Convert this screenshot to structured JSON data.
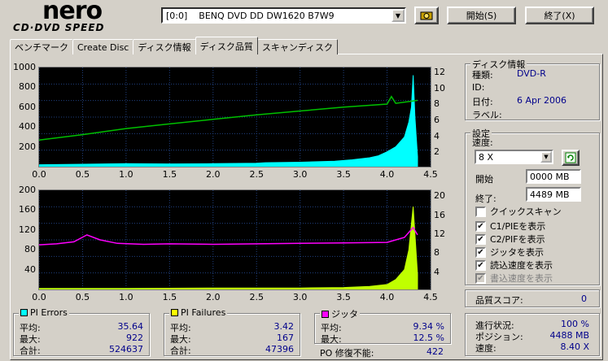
{
  "header": {
    "logo_main": "nero",
    "logo_sub": "CD·DVD SPEED",
    "drive": "[0:0]    BENQ DVD DD DW1620 B7W9",
    "start_button": "開始(S)",
    "exit_button": "終了(X)"
  },
  "tabs": [
    {
      "label": "ベンチマーク"
    },
    {
      "label": "Create Disc"
    },
    {
      "label": "ディスク情報"
    },
    {
      "label": "ディスク品質",
      "active": true
    },
    {
      "label": "スキャンディスク"
    }
  ],
  "chart_data": [
    {
      "type": "area",
      "x_ticks": [
        "0.0",
        "0.5",
        "1.0",
        "1.5",
        "2.0",
        "2.5",
        "3.0",
        "3.5",
        "4.0",
        "4.5"
      ],
      "y_ticks_left": [
        "1000",
        "800",
        "600",
        "400",
        "200"
      ],
      "y_ticks_right": [
        "12",
        "10",
        "8",
        "6",
        "4",
        "2"
      ],
      "xlim": [
        0,
        4.5
      ],
      "ylim": [
        0,
        1000
      ],
      "ylim_right": [
        0,
        13
      ],
      "grid": true,
      "series": [
        {
          "color": "#00ffff",
          "x": [
            0,
            0.5,
            1.0,
            1.5,
            2.0,
            2.5,
            2.6,
            3.0,
            3.4,
            3.6,
            3.8,
            3.9,
            4.0,
            4.1,
            4.2,
            4.25,
            4.28,
            4.3,
            4.32,
            4.35
          ],
          "y": [
            20,
            25,
            30,
            28,
            30,
            35,
            40,
            45,
            55,
            70,
            90,
            110,
            150,
            200,
            300,
            450,
            600,
            922,
            500,
            100
          ]
        },
        {
          "color": "#00c000",
          "x": [
            0,
            0.5,
            1.0,
            1.5,
            2.0,
            2.5,
            3.0,
            3.5,
            4.0,
            4.05,
            4.1,
            4.35
          ],
          "y": [
            3.5,
            4.2,
            5.0,
            5.6,
            6.2,
            6.8,
            7.3,
            7.8,
            8.2,
            9.2,
            8.3,
            8.7
          ]
        }
      ]
    },
    {
      "type": "area",
      "x_ticks": [
        "0.0",
        "0.5",
        "1.0",
        "1.5",
        "2.0",
        "2.5",
        "3.0",
        "3.5",
        "4.0",
        "4.5"
      ],
      "y_ticks_left": [
        "200",
        "160",
        "120",
        "80",
        "40"
      ],
      "y_ticks_right": [
        "20",
        "16",
        "12",
        "8",
        "4"
      ],
      "xlim": [
        0,
        4.5
      ],
      "ylim": [
        0,
        200
      ],
      "ylim_right": [
        0,
        20
      ],
      "grid": true,
      "series": [
        {
          "color": "#c0ff00",
          "x": [
            0,
            1,
            2,
            3,
            3.5,
            3.8,
            4.0,
            4.1,
            4.2,
            4.25,
            4.3,
            4.35
          ],
          "y": [
            2,
            2,
            3,
            3,
            4,
            6,
            10,
            20,
            40,
            80,
            167,
            30
          ]
        },
        {
          "color": "#ff00ff",
          "x": [
            0,
            0.2,
            0.4,
            0.55,
            0.7,
            0.9,
            1.2,
            1.5,
            2.0,
            2.5,
            3.0,
            3.5,
            4.0,
            4.2,
            4.3,
            4.35
          ],
          "y": [
            9.0,
            9.2,
            9.6,
            11.0,
            10.0,
            9.3,
            9.1,
            9.2,
            9.1,
            9.2,
            9.3,
            9.4,
            9.5,
            10.5,
            12.5,
            11
          ]
        }
      ]
    }
  ],
  "disc_info": {
    "title": "ディスク情報",
    "type_label": "種類:",
    "type_value": "DVD-R",
    "id_label": "ID:",
    "id_value": "",
    "date_label": "日付:",
    "date_value": "6 Apr 2006",
    "label_label": "ラベル:",
    "label_value": ""
  },
  "settings": {
    "title": "設定",
    "speed_label": "速度:",
    "speed_value": "8 X",
    "start_label": "開始",
    "start_value": "0000 MB",
    "end_label": "終了:",
    "end_value": "4489 MB",
    "checks": [
      {
        "label": "クイックスキャン",
        "checked": false,
        "disabled": false
      },
      {
        "label": "C1/PIEを表示",
        "checked": true,
        "disabled": false
      },
      {
        "label": "C2/PIFを表示",
        "checked": true,
        "disabled": false
      },
      {
        "label": "ジッタを表示",
        "checked": true,
        "disabled": false
      },
      {
        "label": "読込速度を表示",
        "checked": true,
        "disabled": false
      },
      {
        "label": "書込速度を表示",
        "checked": true,
        "disabled": true
      }
    ]
  },
  "quality": {
    "label": "品質スコア:",
    "value": "0"
  },
  "pi_errors": {
    "title": "PI Errors",
    "color": "#00ffff",
    "avg_label": "平均:",
    "avg": "35.64",
    "max_label": "最大:",
    "max": "922",
    "total_label": "合計:",
    "total": "524637"
  },
  "pi_failures": {
    "title": "PI Failures",
    "color": "#ffff00",
    "avg_label": "平均:",
    "avg": "3.42",
    "max_label": "最大:",
    "max": "167",
    "total_label": "合計:",
    "total": "47396"
  },
  "jitter": {
    "title": "ジッタ",
    "color": "#ff00ff",
    "avg_label": "平均:",
    "avg": "9.34 %",
    "max_label": "最大:",
    "max": "12.5 %",
    "po_label": "PO 修復不能:",
    "po": "422"
  },
  "progress": {
    "status_label": "進行状況:",
    "status": "100 %",
    "position_label": "ポジション:",
    "position": "4488 MB",
    "speed_label": "速度:",
    "speed": "8.40 X"
  }
}
